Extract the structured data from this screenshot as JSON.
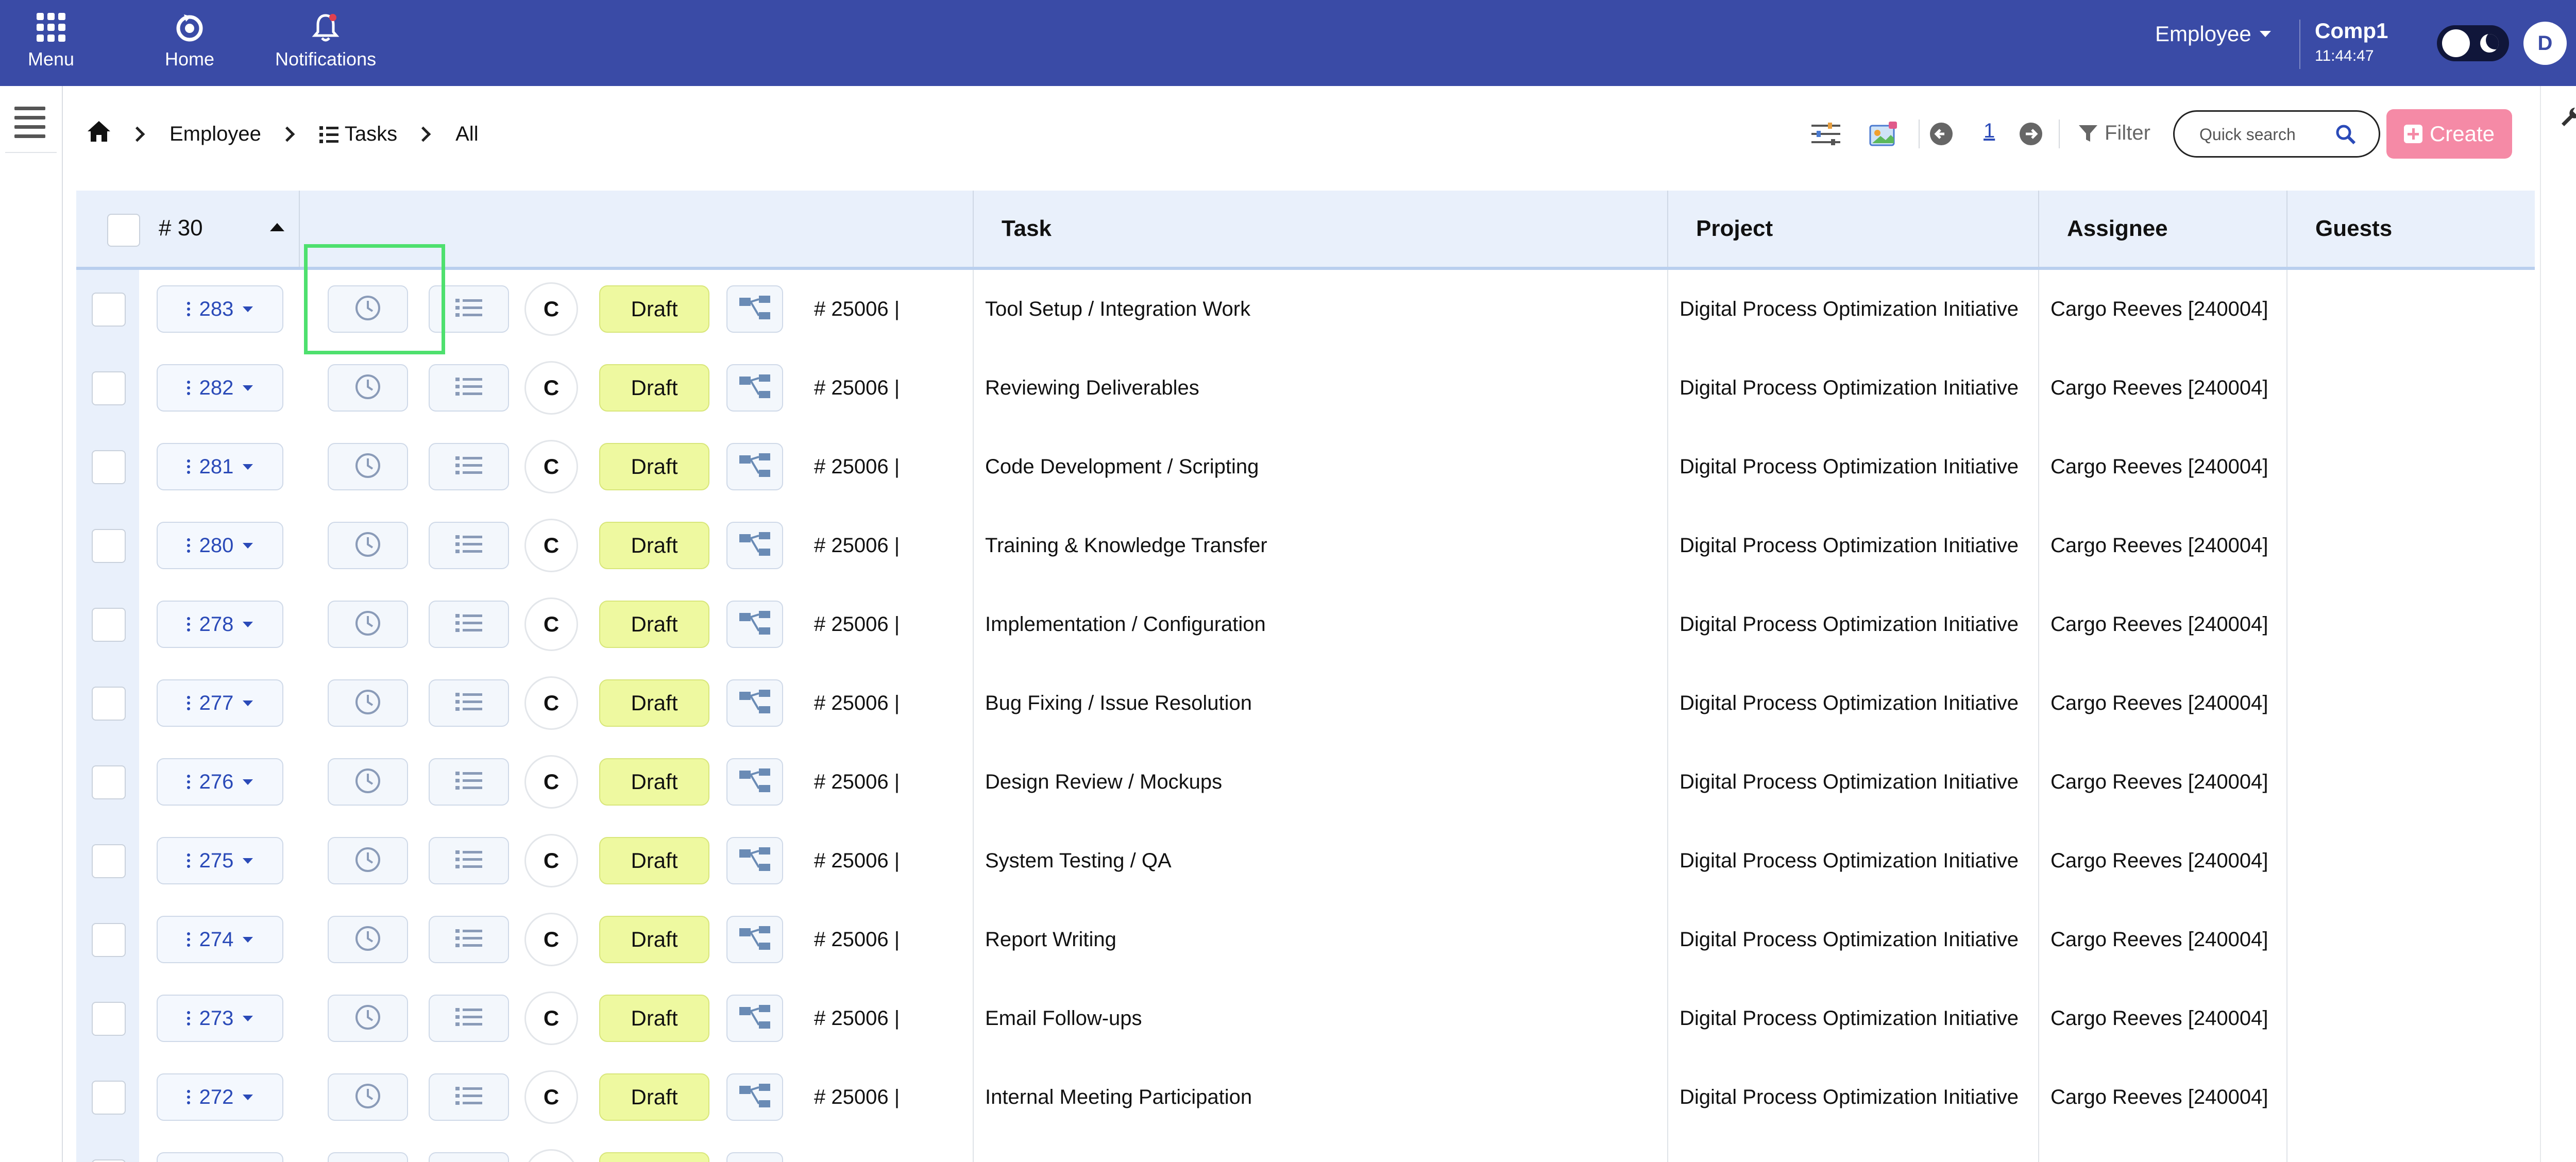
{
  "topbar": {
    "menu_label": "Menu",
    "home_label": "Home",
    "notifications_label": "Notifications",
    "role": "Employee",
    "company_name": "Comp1",
    "company_time": "11:44:47",
    "avatar_initial": "D",
    "accent_color": "#3a4ba6"
  },
  "breadcrumb": {
    "level1": "Employee",
    "level2": "Tasks",
    "level3": "All"
  },
  "toolbar": {
    "page_number": "1",
    "filter_label": "Filter",
    "search_placeholder": "Quick search",
    "create_label": "Create",
    "create_color": "#f58aa6"
  },
  "table": {
    "header": {
      "count_label": "# 30",
      "task": "Task",
      "project": "Project",
      "assignee": "Assignee",
      "guests": "Guests"
    },
    "rows": [
      {
        "id": "283",
        "c": "C",
        "status": "Draft",
        "code": "# 25006 |",
        "task": "Tool Setup / Integration Work",
        "project": "Digital Process Optimization Initiative",
        "assignee": "Cargo Reeves [240004]",
        "guests": ""
      },
      {
        "id": "282",
        "c": "C",
        "status": "Draft",
        "code": "# 25006 |",
        "task": "Reviewing Deliverables",
        "project": "Digital Process Optimization Initiative",
        "assignee": "Cargo Reeves [240004]",
        "guests": ""
      },
      {
        "id": "281",
        "c": "C",
        "status": "Draft",
        "code": "# 25006 |",
        "task": "Code Development / Scripting",
        "project": "Digital Process Optimization Initiative",
        "assignee": "Cargo Reeves [240004]",
        "guests": ""
      },
      {
        "id": "280",
        "c": "C",
        "status": "Draft",
        "code": "# 25006 |",
        "task": "Training & Knowledge Transfer",
        "project": "Digital Process Optimization Initiative",
        "assignee": "Cargo Reeves [240004]",
        "guests": ""
      },
      {
        "id": "278",
        "c": "C",
        "status": "Draft",
        "code": "# 25006 |",
        "task": "Implementation / Configuration",
        "project": "Digital Process Optimization Initiative",
        "assignee": "Cargo Reeves [240004]",
        "guests": ""
      },
      {
        "id": "277",
        "c": "C",
        "status": "Draft",
        "code": "# 25006 |",
        "task": "Bug Fixing / Issue Resolution",
        "project": "Digital Process Optimization Initiative",
        "assignee": "Cargo Reeves [240004]",
        "guests": ""
      },
      {
        "id": "276",
        "c": "C",
        "status": "Draft",
        "code": "# 25006 |",
        "task": "Design Review / Mockups",
        "project": "Digital Process Optimization Initiative",
        "assignee": "Cargo Reeves [240004]",
        "guests": ""
      },
      {
        "id": "275",
        "c": "C",
        "status": "Draft",
        "code": "# 25006 |",
        "task": "System Testing / QA",
        "project": "Digital Process Optimization Initiative",
        "assignee": "Cargo Reeves [240004]",
        "guests": ""
      },
      {
        "id": "274",
        "c": "C",
        "status": "Draft",
        "code": "# 25006 |",
        "task": "Report Writing",
        "project": "Digital Process Optimization Initiative",
        "assignee": "Cargo Reeves [240004]",
        "guests": ""
      },
      {
        "id": "273",
        "c": "C",
        "status": "Draft",
        "code": "# 25006 |",
        "task": "Email Follow-ups",
        "project": "Digital Process Optimization Initiative",
        "assignee": "Cargo Reeves [240004]",
        "guests": ""
      },
      {
        "id": "272",
        "c": "C",
        "status": "Draft",
        "code": "# 25006 |",
        "task": "Internal Meeting Participation",
        "project": "Digital Process Optimization Initiative",
        "assignee": "Cargo Reeves [240004]",
        "guests": ""
      },
      {
        "id": "",
        "c": "",
        "status": "",
        "code": "",
        "task": "",
        "project": "",
        "assignee": "",
        "guests": ""
      }
    ]
  },
  "status_colors": {
    "draft": "#eef9a0"
  },
  "highlight_color": "#4ee06e"
}
